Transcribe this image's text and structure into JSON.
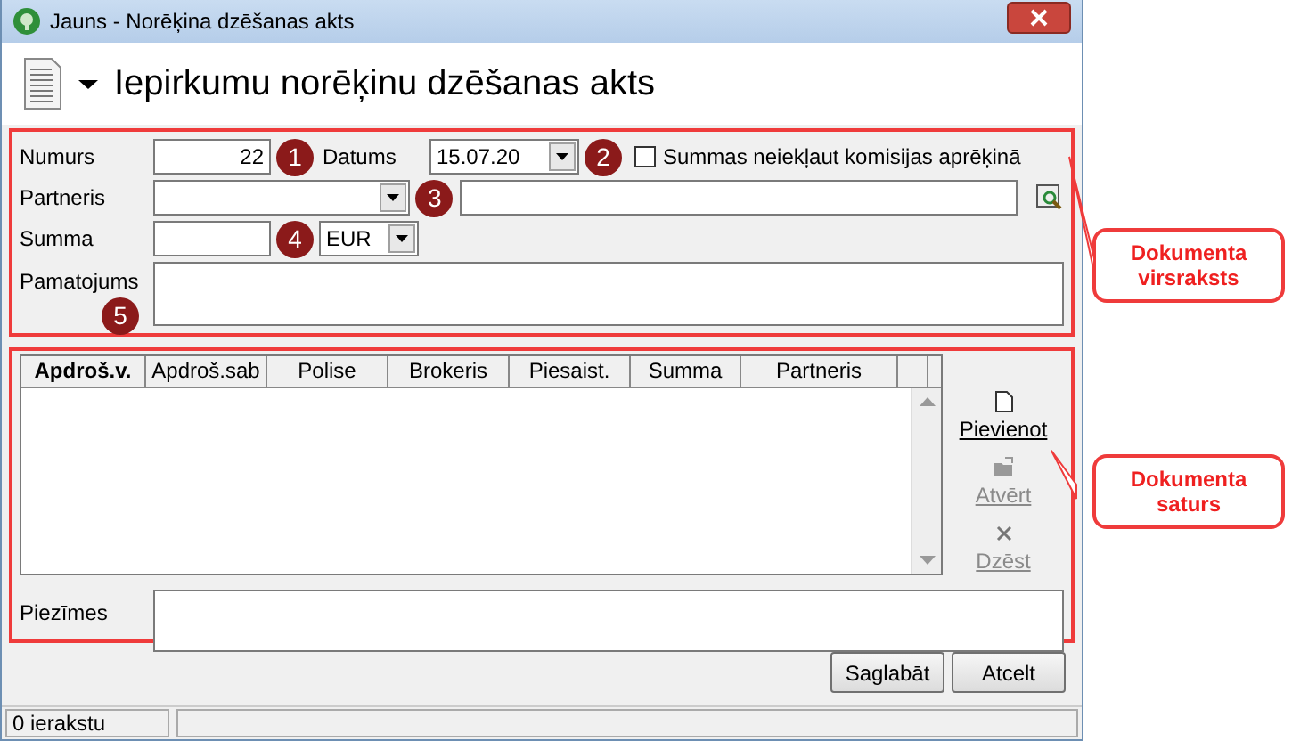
{
  "window": {
    "title": "Jauns - Norēķina dzēšanas akts"
  },
  "header": {
    "title": "Iepirkumu norēķinu dzēšanas akts"
  },
  "form": {
    "number": {
      "label": "Numurs",
      "value": "22"
    },
    "date": {
      "label": "Datums",
      "value": "15.07.20"
    },
    "exclude_commission": {
      "label": "Summas neiekļaut komisijas aprēķinā",
      "checked": false
    },
    "partner": {
      "label": "Partneris"
    },
    "amount": {
      "label": "Summa",
      "currency": "EUR"
    },
    "justification": {
      "label": "Pamatojums"
    }
  },
  "markers": [
    "1",
    "2",
    "3",
    "4",
    "5"
  ],
  "table": {
    "columns": [
      {
        "label": "Apdroš.v.",
        "sorted": true
      },
      {
        "label": "Apdroš.sab",
        "sorted": false
      },
      {
        "label": "Polise",
        "sorted": false
      },
      {
        "label": "Brokeris",
        "sorted": false
      },
      {
        "label": "Piesaist.",
        "sorted": false
      },
      {
        "label": "Summa",
        "sorted": false
      },
      {
        "label": "Partneris",
        "sorted": false
      }
    ]
  },
  "side_actions": [
    {
      "label": "Pievienot",
      "disabled": false,
      "kind": "new"
    },
    {
      "label": "Atvērt",
      "disabled": true,
      "kind": "open"
    },
    {
      "label": "Dzēst",
      "disabled": true,
      "kind": "delete"
    }
  ],
  "notes": {
    "label": "Piezīmes"
  },
  "buttons": [
    "Saglabāt",
    "Atcelt"
  ],
  "status_bar": [
    "0 ierakstu"
  ],
  "callouts": [
    "Dokumenta virsraksts",
    "Dokumenta saturs"
  ]
}
